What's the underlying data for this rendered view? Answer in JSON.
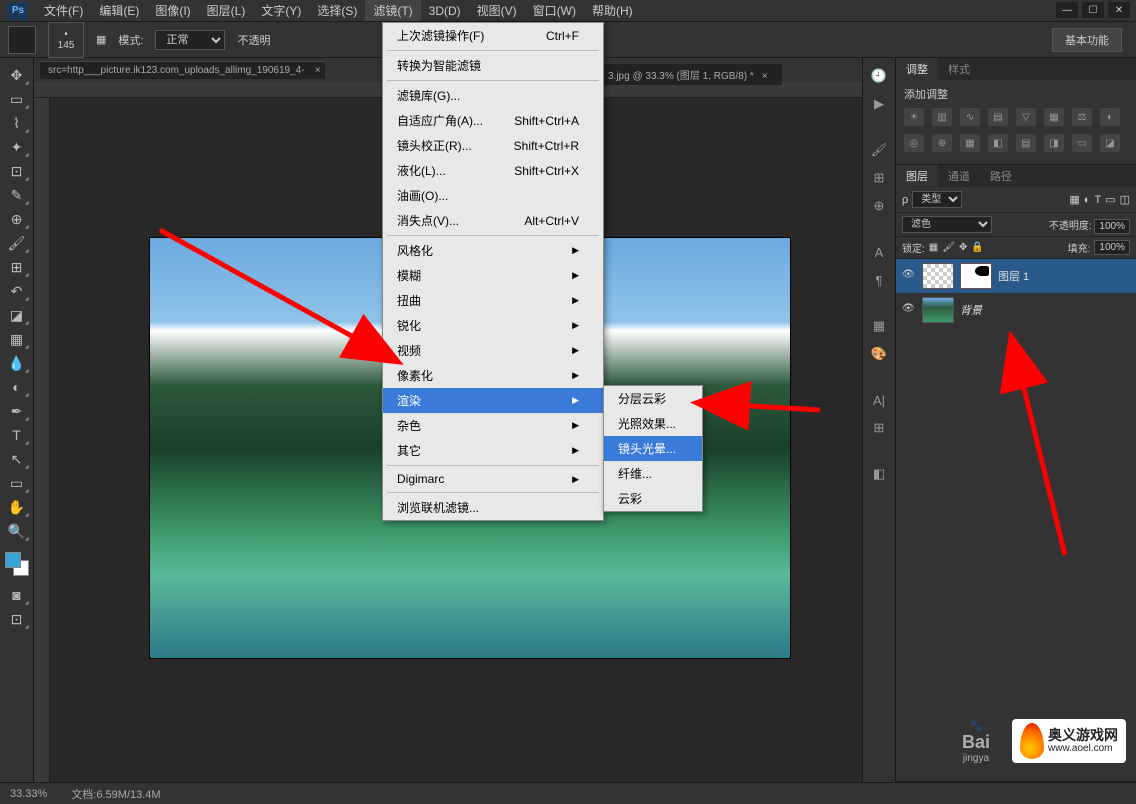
{
  "menubar": {
    "items": [
      "文件(F)",
      "编辑(E)",
      "图像(I)",
      "图层(L)",
      "文字(Y)",
      "选择(S)",
      "滤镜(T)",
      "3D(D)",
      "视图(V)",
      "窗口(W)",
      "帮助(H)"
    ],
    "active_index": 6
  },
  "optionsbar": {
    "brush_size": "145",
    "mode_label": "模式:",
    "mode_value": "正常",
    "opacity_label": "不透明",
    "workspace_btn": "基本功能"
  },
  "tab": {
    "title": "src=http___picture.ik123.com_uploads_allimg_190619_4-",
    "title_right": "3.jpg @ 33.3% (图层 1, RGB/8) *"
  },
  "filter_menu": {
    "top": {
      "label": "上次滤镜操作(F)",
      "shortcut": "Ctrl+F"
    },
    "smart": "转换为智能滤镜",
    "gallery": "滤镜库(G)...",
    "adaptive": {
      "label": "自适应广角(A)...",
      "shortcut": "Shift+Ctrl+A"
    },
    "lens": {
      "label": "镜头校正(R)...",
      "shortcut": "Shift+Ctrl+R"
    },
    "liquify": {
      "label": "液化(L)...",
      "shortcut": "Shift+Ctrl+X"
    },
    "oil": "油画(O)...",
    "vanish": {
      "label": "消失点(V)...",
      "shortcut": "Alt+Ctrl+V"
    },
    "groups": [
      "风格化",
      "模糊",
      "扭曲",
      "锐化",
      "视频",
      "像素化",
      "渲染",
      "杂色",
      "其它"
    ],
    "highlighted_index": 6,
    "digimarc": "Digimarc",
    "browse": "浏览联机滤镜..."
  },
  "render_submenu": {
    "items": [
      "分层云彩",
      "光照效果...",
      "镜头光晕...",
      "纤维...",
      "云彩"
    ],
    "highlighted_index": 2
  },
  "adjustments_panel": {
    "tabs": [
      "调整",
      "样式"
    ],
    "title": "添加调整"
  },
  "layers_panel": {
    "tabs": [
      "图层",
      "通道",
      "路径"
    ],
    "kind_label": "类型",
    "blend_mode": "滤色",
    "opacity_label": "不透明度:",
    "opacity_value": "100%",
    "lock_label": "锁定:",
    "fill_label": "填充:",
    "fill_value": "100%",
    "layers": [
      {
        "name": "图层 1",
        "selected": true,
        "mask": true
      },
      {
        "name": "背景",
        "selected": false,
        "mask": false
      }
    ]
  },
  "statusbar": {
    "zoom": "33.33%",
    "doc": "文档:6.59M/13.4M"
  },
  "watermark": {
    "baidu": "Bai",
    "baidu_sub": "jingya",
    "site_name": "奥义游戏网",
    "site_url": "www.aoel.com"
  }
}
